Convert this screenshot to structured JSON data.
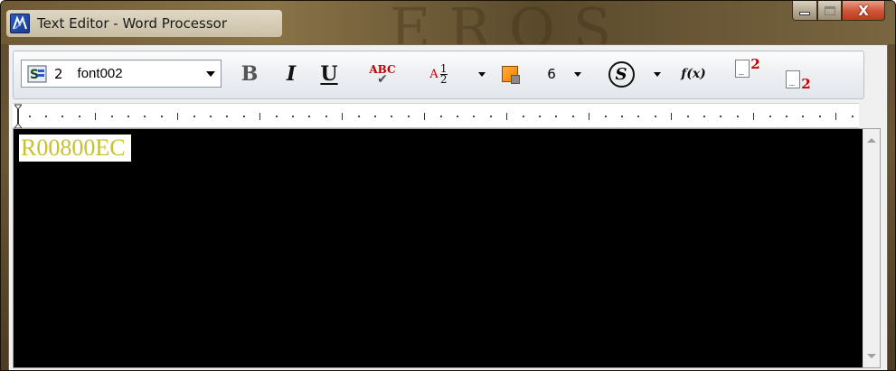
{
  "window": {
    "title": "Text Editor - Word Processor",
    "background_text": "EROS"
  },
  "window_buttons": {
    "minimize_icon": "minimize-icon",
    "maximize_icon": "maximize-icon",
    "close_label": "X"
  },
  "toolbar": {
    "font_number": "2",
    "font_name": "font002",
    "bold_label": "B",
    "italic_label": "I",
    "underline_label": "U",
    "spellcheck_label": "ABC",
    "fraction_prefix": "A",
    "fraction_numerator": "1",
    "fraction_denominator": "2",
    "size_value": "6",
    "style_label": "S",
    "function_label": "f(x)",
    "superscript_label": "2",
    "subscript_label": "2"
  },
  "editor": {
    "text": "R00800EC",
    "text_color": "#c8c030",
    "background_color": "#000000"
  },
  "colors": {
    "accent_red": "#c00000",
    "color_swatch": "#ff8a10"
  }
}
